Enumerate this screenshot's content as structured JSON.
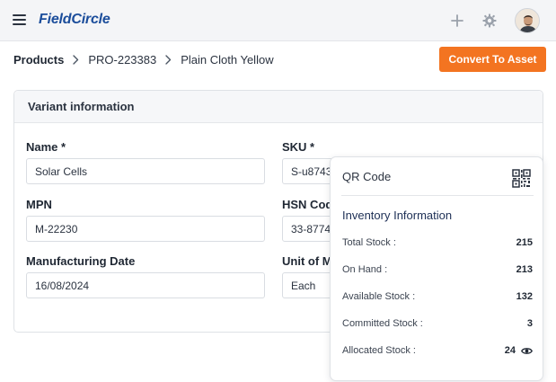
{
  "header": {
    "logo": "FieldCircle",
    "menu_icon": "hamburger-menu-icon",
    "add_icon": "plus-icon",
    "settings_icon": "gear-icon",
    "avatar_icon": "user-avatar"
  },
  "breadcrumb": {
    "root": "Products",
    "code": "PRO-223383",
    "current": "Plain Cloth Yellow"
  },
  "actions": {
    "convert_label": "Convert To Asset",
    "convert_color": "#f37421"
  },
  "variant": {
    "section_title": "Variant information",
    "fields": {
      "name": {
        "label": "Name *",
        "value": "Solar Cells"
      },
      "sku": {
        "label": "SKU *",
        "value": "S-u8743"
      },
      "mpn": {
        "label": "MPN",
        "value": "M-22230"
      },
      "hsn": {
        "label": "HSN Cod",
        "value": "33-8774"
      },
      "mfg_date": {
        "label": "Manufacturing Date",
        "value": "16/08/2024"
      },
      "unit": {
        "label": "Unit of M",
        "value": "Each"
      }
    }
  },
  "popover": {
    "qr_label": "QR Code",
    "qr_icon": "qr-code-icon",
    "inventory_title": "Inventory Information",
    "rows": [
      {
        "label": "Total Stock :",
        "value": "215"
      },
      {
        "label": "On Hand :",
        "value": "213"
      },
      {
        "label": "Available Stock :",
        "value": "132"
      },
      {
        "label": "Committed Stock :",
        "value": "3"
      },
      {
        "label": "Allocated Stock :",
        "value": "24",
        "icon": "eye-icon"
      }
    ]
  }
}
